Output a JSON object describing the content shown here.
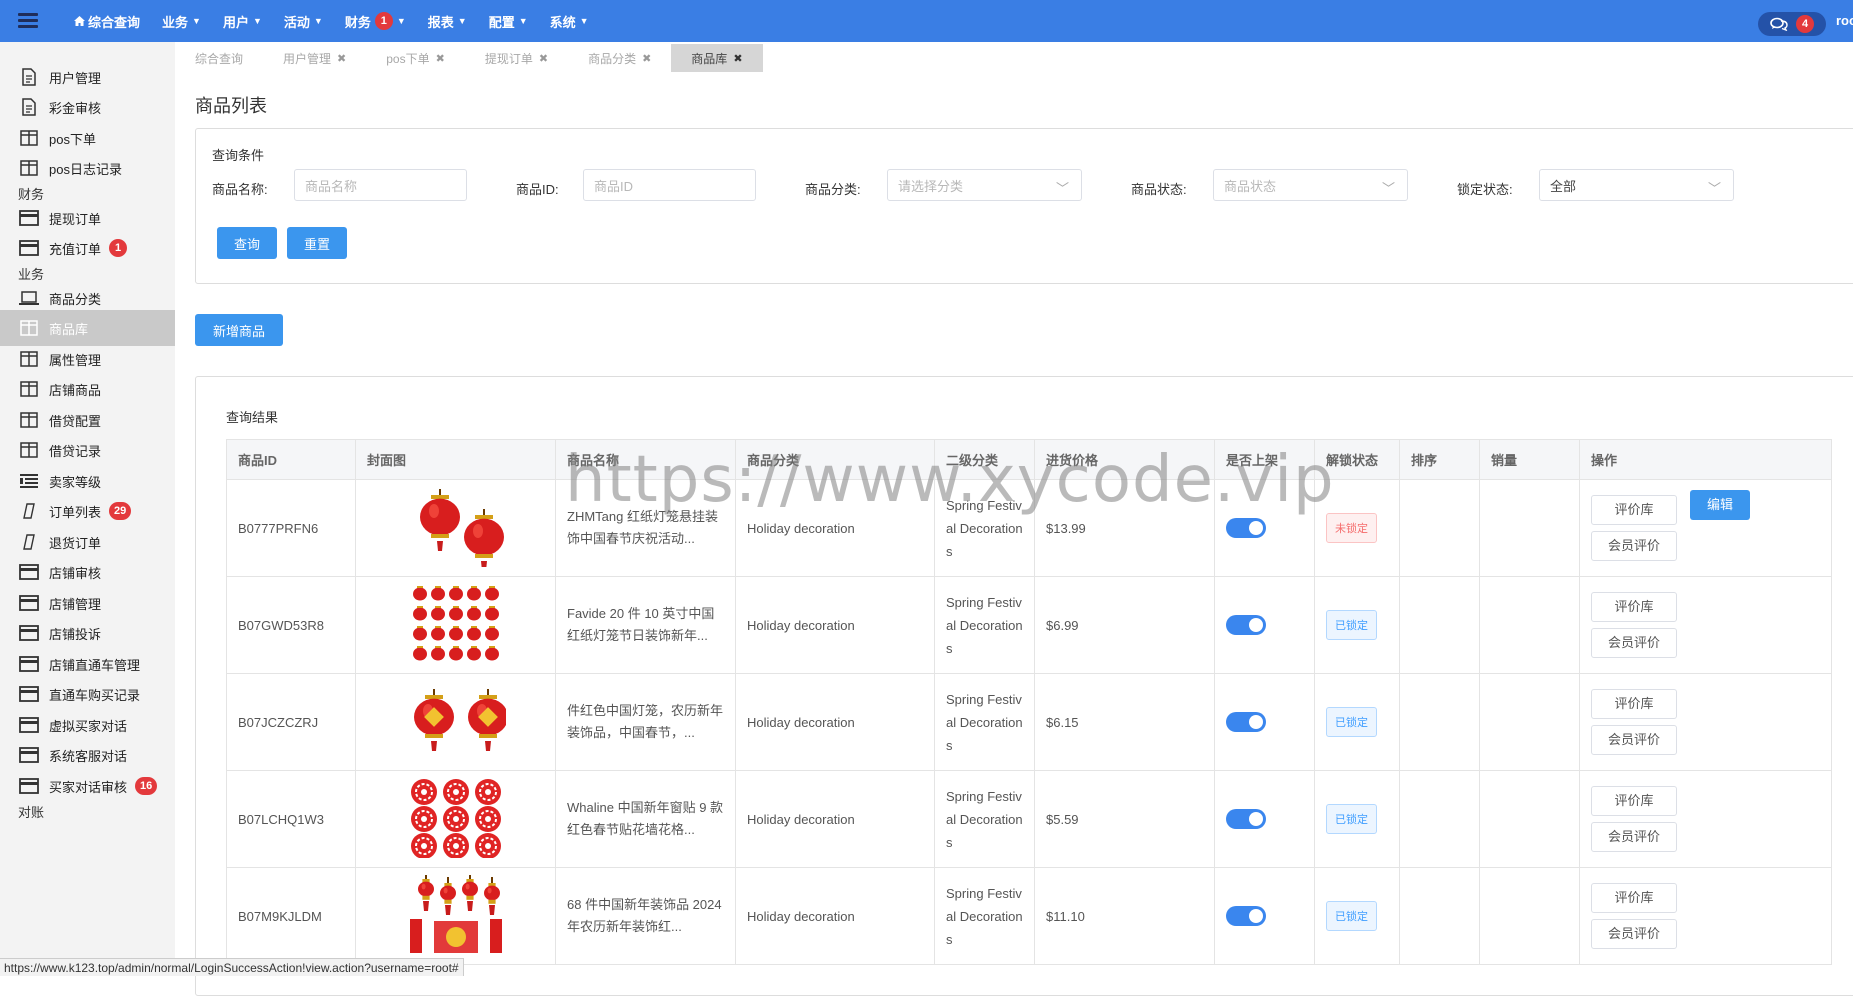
{
  "topnav": {
    "items": [
      {
        "label": "综合查询",
        "icon": "home-icon",
        "caret": false
      },
      {
        "label": "业务",
        "caret": true
      },
      {
        "label": "用户",
        "caret": true
      },
      {
        "label": "活动",
        "caret": true
      },
      {
        "label": "财务",
        "caret": true,
        "badge": "1"
      },
      {
        "label": "报表",
        "caret": true
      },
      {
        "label": "配置",
        "caret": true
      },
      {
        "label": "系统",
        "caret": true
      }
    ],
    "messages_badge": "4",
    "user_truncated": "roo"
  },
  "sidebar": {
    "items": [
      {
        "label": "用户管理",
        "icon": "document-icon"
      },
      {
        "label": "彩金审核",
        "icon": "document-icon"
      },
      {
        "label": "pos下单",
        "icon": "columns-icon"
      },
      {
        "label": "pos日志记录",
        "icon": "columns-icon"
      },
      {
        "label": "提现订单",
        "icon": "card-icon"
      },
      {
        "label": "充值订单",
        "icon": "card-icon",
        "badge": "1"
      },
      {
        "label": "商品分类",
        "icon": "laptop-icon"
      },
      {
        "label": "商品库",
        "icon": "columns-icon",
        "active": true
      },
      {
        "label": "属性管理",
        "icon": "columns-icon"
      },
      {
        "label": "店铺商品",
        "icon": "columns-icon"
      },
      {
        "label": "借贷配置",
        "icon": "columns-icon"
      },
      {
        "label": "借贷记录",
        "icon": "columns-icon"
      },
      {
        "label": "卖家等级",
        "icon": "list-icon"
      },
      {
        "label": "订单列表",
        "icon": "slash-icon",
        "badge": "29"
      },
      {
        "label": "退货订单",
        "icon": "slash-icon"
      },
      {
        "label": "店铺审核",
        "icon": "card-icon"
      },
      {
        "label": "店铺管理",
        "icon": "card-icon"
      },
      {
        "label": "店铺投诉",
        "icon": "card-icon"
      },
      {
        "label": "店铺直通车管理",
        "icon": "card-icon"
      },
      {
        "label": "直通车购买记录",
        "icon": "card-icon"
      },
      {
        "label": "虚拟买家对话",
        "icon": "card-icon"
      },
      {
        "label": "系统客服对话",
        "icon": "card-icon"
      },
      {
        "label": "买家对话审核",
        "icon": "card-icon",
        "badge": "16"
      }
    ],
    "groups": [
      "财务",
      "业务",
      "对账"
    ]
  },
  "tabs": [
    {
      "label": "综合查询",
      "closable": false
    },
    {
      "label": "用户管理",
      "closable": true
    },
    {
      "label": "pos下单",
      "closable": true
    },
    {
      "label": "提现订单",
      "closable": true
    },
    {
      "label": "商品分类",
      "closable": true
    },
    {
      "label": "商品库",
      "closable": true,
      "active": true
    }
  ],
  "page": {
    "title": "商品列表"
  },
  "query": {
    "title": "查询条件",
    "name_label": "商品名称:",
    "name_placeholder": "商品名称",
    "id_label": "商品ID:",
    "id_placeholder": "商品ID",
    "category_label": "商品分类:",
    "category_placeholder": "请选择分类",
    "status_label": "商品状态:",
    "status_placeholder": "商品状态",
    "lock_label": "锁定状态:",
    "lock_value": "全部",
    "search_button": "查询",
    "reset_button": "重置"
  },
  "add_button": "新增商品",
  "results": {
    "title": "查询结果",
    "columns": [
      "商品ID",
      "封面图",
      "商品名称",
      "商品分类",
      "二级分类",
      "进货价格",
      "是否上架",
      "解锁状态",
      "排序",
      "销量",
      "操作"
    ],
    "rows": [
      {
        "id": "B0777PRFN6",
        "name": "ZHMTang 红纸灯笼悬挂装饰中国春节庆祝活动...",
        "category": "Holiday decoration",
        "subcategory": "Spring Festival Decorations",
        "price": "$13.99",
        "listed": true,
        "lock_status": "未锁定",
        "locked": false,
        "image": "lanterns-pair"
      },
      {
        "id": "B07GWD53R8",
        "name": "Favide 20 件 10 英寸中国红纸灯笼节日装饰新年...",
        "category": "Holiday decoration",
        "subcategory": "Spring Festival Decorations",
        "price": "$6.99",
        "listed": true,
        "lock_status": "已锁定",
        "locked": true,
        "image": "lanterns-many"
      },
      {
        "id": "B07JCZCZRJ",
        "name": "件红色中国灯笼，农历新年装饰品，中国春节，...",
        "category": "Holiday decoration",
        "subcategory": "Spring Festival Decorations",
        "price": "$6.15",
        "listed": true,
        "lock_status": "已锁定",
        "locked": true,
        "image": "lanterns-fu"
      },
      {
        "id": "B07LCHQ1W3",
        "name": "Whaline 中国新年窗贴 9 款红色春节贴花墙花格...",
        "category": "Holiday decoration",
        "subcategory": "Spring Festival Decorations",
        "price": "$5.59",
        "listed": true,
        "lock_status": "已锁定",
        "locked": true,
        "image": "window-stickers"
      },
      {
        "id": "B07M9KJLDM",
        "name": "68 件中国新年装饰品 2024 年农历新年装饰红...",
        "category": "Holiday decoration",
        "subcategory": "Spring Festival Decorations",
        "price": "$11.10",
        "listed": true,
        "lock_status": "已锁定",
        "locked": true,
        "image": "decor-set"
      }
    ],
    "op_review_lib": "评价库",
    "op_member_review": "会员评价",
    "op_edit": "编辑"
  },
  "status_bar_url": "https://www.k123.top/admin/normal/LoginSuccessAction!view.action?username=root#",
  "watermark": "https://www.xycode.vip",
  "colors": {
    "topbar": "#3a7ee4",
    "primary_button": "#3b96ee",
    "badge": "#e3393c",
    "toggle_on": "#3a86ee"
  }
}
